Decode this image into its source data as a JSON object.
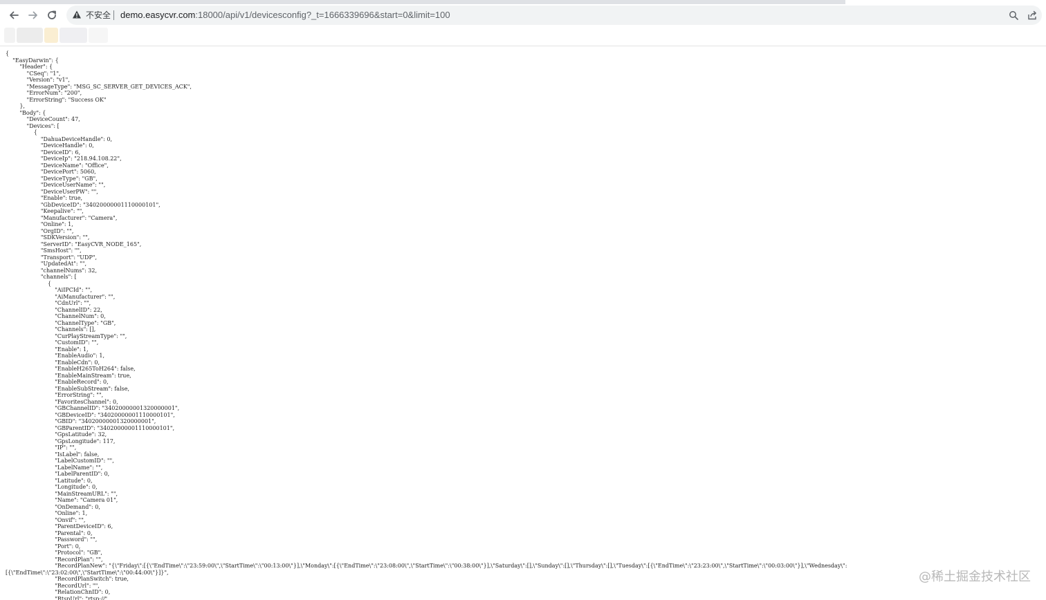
{
  "browser": {
    "security_label": "不安全",
    "url_host": "demo.easycvr.com",
    "url_rest": ":18000/api/v1/devicesconfig?_t=1666339696&start=0&limit=100",
    "icons": {
      "back": "back-arrow-icon",
      "forward": "forward-arrow-icon",
      "reload": "reload-icon",
      "security": "warning-triangle-icon",
      "zoom": "zoom-icon",
      "share": "share-icon"
    }
  },
  "json_text": "{\n    \"EasyDarwin\": {\n        \"Header\": {\n            \"CSeq\": \"1\",\n            \"Version\": \"v1\",\n            \"MessageType\": \"MSG_SC_SERVER_GET_DEVICES_ACK\",\n            \"ErrorNum\": \"200\",\n            \"ErrorString\": \"Success OK\"\n        },\n        \"Body\": {\n            \"DeviceCount\": 47,\n            \"Devices\": [\n                {\n                    \"DahuaDeviceHandle\": 0,\n                    \"DeviceHandle\": 0,\n                    \"DeviceID\": 6,\n                    \"DeviceIp\": \"218.94.108.22\",\n                    \"DeviceName\": \"Office\",\n                    \"DevicePort\": 5060,\n                    \"DeviceType\": \"GB\",\n                    \"DeviceUserName\": \"\",\n                    \"DeviceUserPW\": \"\",\n                    \"Enable\": true,\n                    \"GbDeviceID\": \"34020000001110000101\",\n                    \"Keepalive\": \"\",\n                    \"Manufacturer\": \"Camera\",\n                    \"Online\": 1,\n                    \"OrgID\": \"\",\n                    \"SDKVersion\": \"\",\n                    \"ServerID\": \"EasyCVR_NODE_165\",\n                    \"SmsHost\": \"\",\n                    \"Transport\": \"UDP\",\n                    \"UpdatedAt\": \"\",\n                    \"channelNums\": 32,\n                    \"channels\": [\n                        {\n                            \"AiIPCId\": \"\",\n                            \"AiManufacturer\": \"\",\n                            \"CdnUrl\": \"\",\n                            \"ChannelID\": 22,\n                            \"ChannelNum\": 0,\n                            \"ChannelType\": \"GB\",\n                            \"Channels\": [],\n                            \"CurPlayStreamType\": \"\",\n                            \"CustomID\": \"\",\n                            \"Enable\": 1,\n                            \"EnableAudio\": 1,\n                            \"EnableCdn\": 0,\n                            \"EnableH265ToH264\": false,\n                            \"EnableMainStream\": true,\n                            \"EnableRecord\": 0,\n                            \"EnableSubStream\": false,\n                            \"ErrorString\": \"\",\n                            \"FavoritesChannel\": 0,\n                            \"GBChannelID\": \"34020000001320000001\",\n                            \"GBDeviceID\": \"34020000001110000101\",\n                            \"GBID\": \"34020000001320000001\",\n                            \"GBParentID\": \"34020000001110000101\",\n                            \"GpsLatitude\": 32,\n                            \"GpsLongitude\": 117,\n                            \"IP\": \"\",\n                            \"IsLabel\": false,\n                            \"LabelCustomID\": \"\",\n                            \"LabelName\": \"\",\n                            \"LabelParentID\": 0,\n                            \"Latitude\": 0,\n                            \"Longitude\": 0,\n                            \"MainStreamURL\": \"\",\n                            \"Name\": \"Camera 01\",\n                            \"OnDemand\": 0,\n                            \"Online\": 1,\n                            \"Onvif\": \"\",\n                            \"ParentDeviceID\": 6,\n                            \"Parental\": 0,\n                            \"Password\": \"\",\n                            \"Port\": 0,\n                            \"Protocol\": \"GB\",\n                            \"RecordPlan\": \"\",\n                            \"RecordPlanNew\": \"{\\\"Friday\\\":[{\\\"EndTime\\\":\\\"23:59:00\\\",\\\"StartTime\\\":\\\"00:13:00\\\"}],\\\"Monday\\\":[{\\\"EndTime\\\":\\\"23:08:00\\\",\\\"StartTime\\\":\\\"00:38:00\\\"}],\\\"Saturday\\\":[],\\\"Sunday\\\":[],\\\"Thursday\\\":[],\\\"Tuesday\\\":[{\\\"EndTime\\\":\\\"23:23:00\\\",\\\"StartTime\\\":\\\"00:03:00\\\"}],\\\"Wednesday\\\":\n[{\\\"EndTime\\\":\\\"23:02:00\\\",\\\"StartTime\\\":\\\"00:44:00\\\"}]}\",\n                            \"RecordPlanSwitch\": true,\n                            \"RecordUrl\": \"\",\n                            \"RelationChnID\": 0,\n                            \"RtspUrl\": \"rtsp://\"",
  "watermark": "@稀土掘金技术社区"
}
